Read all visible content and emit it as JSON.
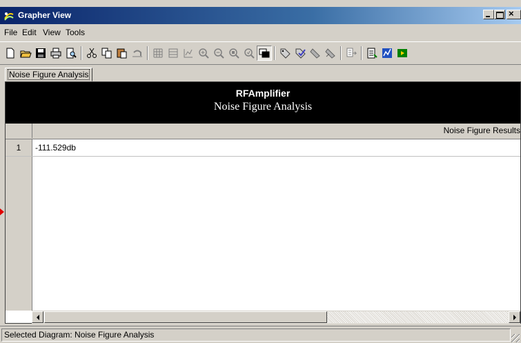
{
  "window": {
    "title": "Grapher View",
    "close_glyph": "×"
  },
  "menu": [
    "File",
    "Edit",
    "View",
    "Tools"
  ],
  "tabs": [
    {
      "label": "Noise Figure Analysis"
    }
  ],
  "diagram": {
    "title": "RFAmplifier",
    "subtitle": "Noise Figure Analysis",
    "column_header": "Noise Figure Results",
    "rows": [
      {
        "index": "1",
        "value": "-111.529db"
      }
    ]
  },
  "statusbar": {
    "text": "Selected Diagram:  Noise Figure Analysis"
  },
  "toolbar_icons": [
    "new-icon",
    "open-icon",
    "save-icon",
    "print-icon",
    "print-preview-icon",
    "cut-icon",
    "copy-icon",
    "paste-icon",
    "undo-icon",
    "grid-icon",
    "table-icon",
    "chart-icon",
    "zoom-in-icon",
    "zoom-out-icon",
    "zoom-fit-icon",
    "zoom-area-icon",
    "window-icon",
    "tag-icon",
    "check-icon",
    "marker-icon",
    "marker-delete-icon",
    "export-icon",
    "report-icon",
    "chart-edit-icon",
    "run-icon"
  ],
  "colors": {
    "title_bar_start": "#0a246a",
    "title_bar_end": "#a6caf0",
    "chrome": "#d4d0c8",
    "diagram_header": "#000000",
    "marker": "#e00000"
  }
}
